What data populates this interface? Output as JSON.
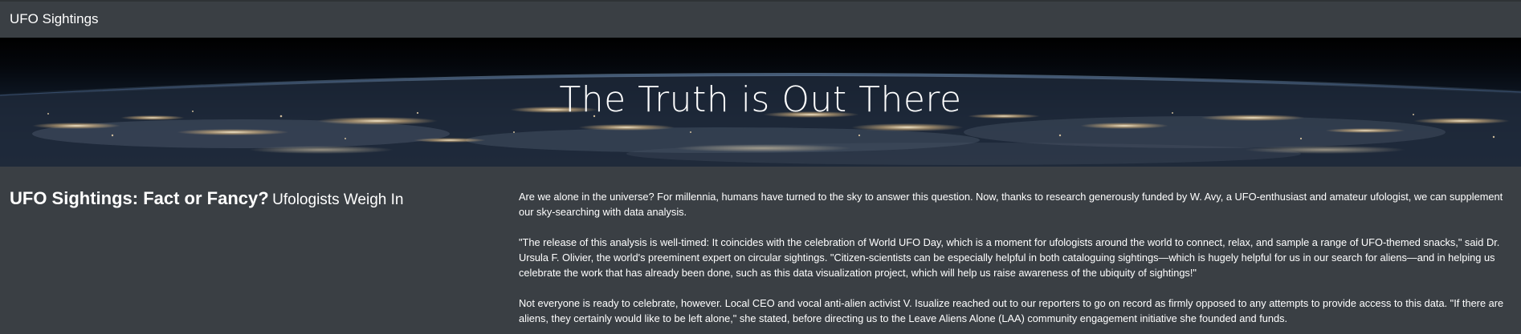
{
  "navbar": {
    "brand": "UFO Sightings"
  },
  "hero": {
    "title": "The Truth is Out There"
  },
  "article": {
    "heading_main": "UFO Sightings: Fact or Fancy?",
    "heading_sub": "Ufologists Weigh In",
    "paragraphs": [
      "Are we alone in the universe? For millennia, humans have turned to the sky to answer this question. Now, thanks to research generously funded by W. Avy, a UFO-enthusiast and amateur ufologist, we can supplement our sky-searching with data analysis.",
      "\"The release of this analysis is well-timed: It coincides with the celebration of World UFO Day, which is a moment for ufologists around the world to connect, relax, and sample a range of UFO-themed snacks,\" said Dr. Ursula F. Olivier, the world's preeminent expert on circular sightings. \"Citizen-scientists can be especially helpful in both cataloguing sightings—which is hugely helpful for us in our search for aliens—and in helping us celebrate the work that has already been done, such as this data visualization project, which will help us raise awareness of the ubiquity of sightings!\"",
      "Not everyone is ready to celebrate, however. Local CEO and vocal anti-alien activist V. Isualize reached out to our reporters to go on record as firmly opposed to any attempts to provide access to this data. \"If there are aliens, they certainly would like to be left alone,\" she stated, before directing us to the Leave Aliens Alone (LAA) community engagement initiative she founded and funds."
    ]
  },
  "colors": {
    "background": "#3a3f44",
    "text": "#ffffff",
    "hero_dark": "#000000",
    "city_lights": "#f2c98a"
  }
}
